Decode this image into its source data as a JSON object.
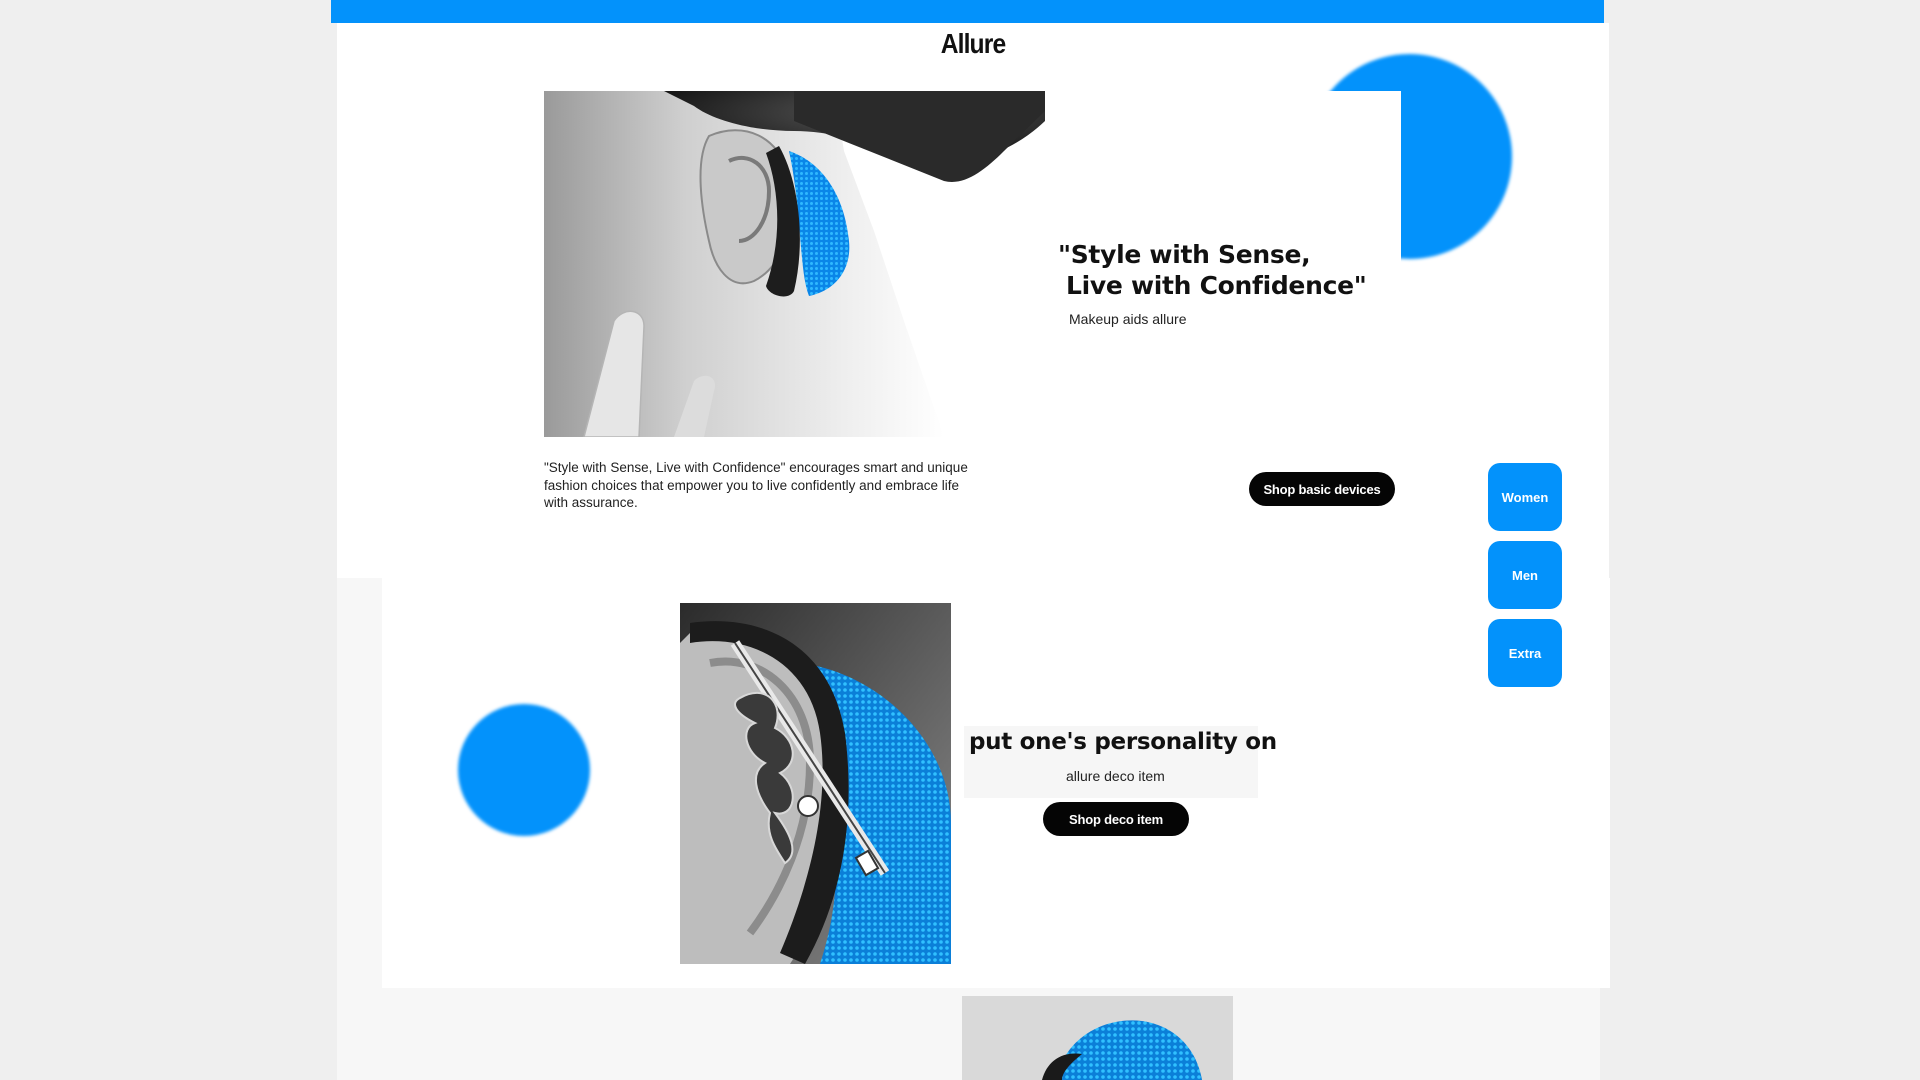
{
  "header": {
    "brand": "Allure"
  },
  "hero": {
    "headline_line1": "\"Style with Sense,",
    "headline_line2": "Live with Confidence\"",
    "subtitle": "Makeup aids allure",
    "description": "\"Style with Sense, Live with Confidence\" encourages smart and unique fashion choices that empower you to live confidently and embrace life with assurance.",
    "cta_label": "Shop basic devices"
  },
  "categories": [
    {
      "label": "Women"
    },
    {
      "label": "Men"
    },
    {
      "label": "Extra"
    }
  ],
  "deco": {
    "headline": "put one's personality on",
    "subtitle": "allure deco item",
    "cta_label": "Shop deco item"
  },
  "colors": {
    "accent": "#0392fb",
    "button_dark": "#050505",
    "background": "#efefef"
  }
}
